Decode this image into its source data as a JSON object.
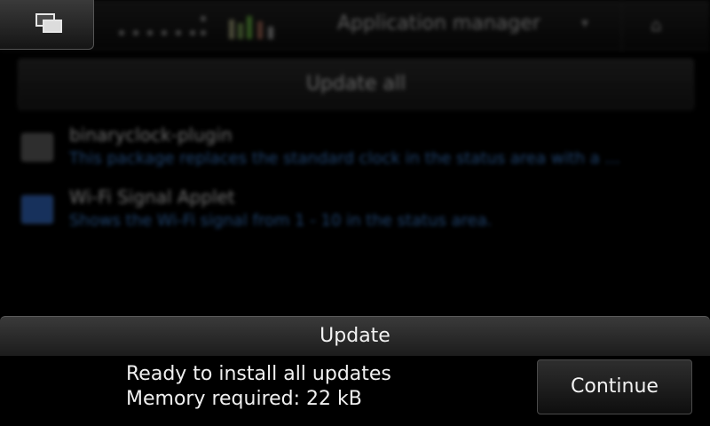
{
  "background_app": {
    "title": "Application manager",
    "update_all_label": "Update all",
    "packages": [
      {
        "name": "binaryclock-plugin",
        "description": "This package replaces the standard clock in the status area with a ...",
        "icon_color": "#555555"
      },
      {
        "name": "Wi-Fi Signal Applet",
        "description": "Shows the Wi-Fi signal from 1 - 10 in the status area.",
        "icon_color": "#2a5aa8"
      }
    ]
  },
  "dialog": {
    "title": "Update",
    "line1": "Ready to install all updates",
    "line2": "Memory required: 22 kB",
    "continue_label": "Continue"
  },
  "icons": {
    "switcher": "task-switcher-icon",
    "chevron": "▾",
    "close": "⌂"
  }
}
